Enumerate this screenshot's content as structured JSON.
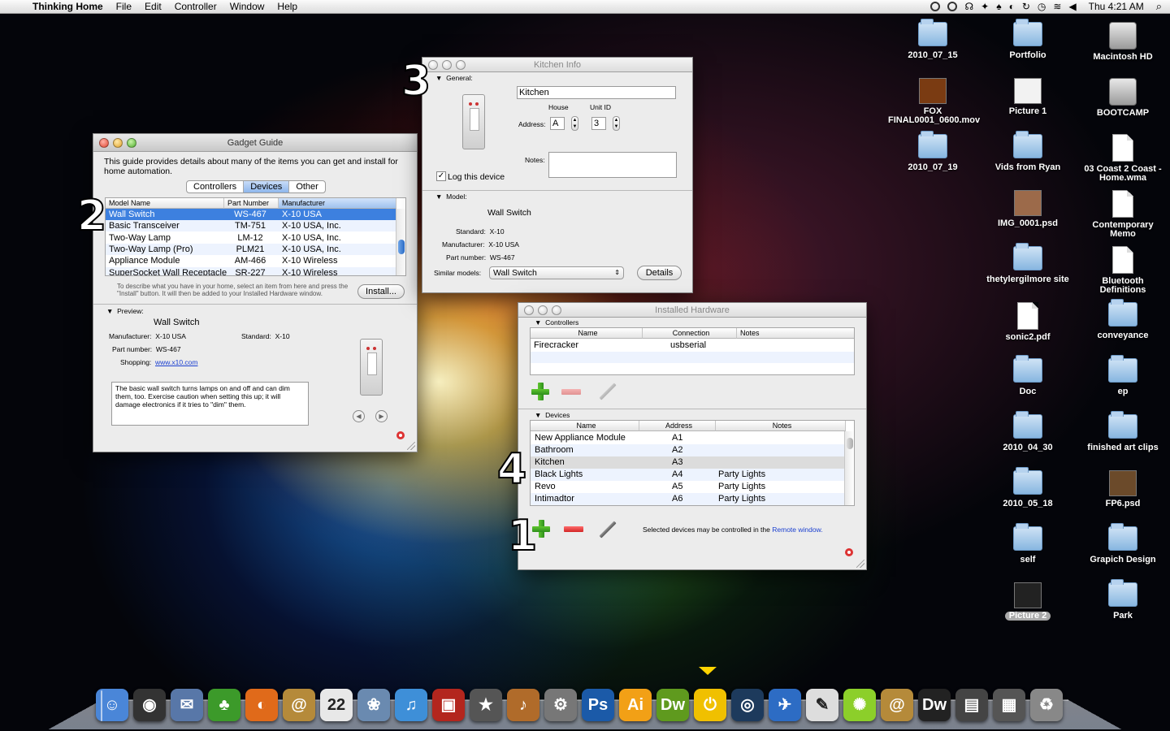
{
  "menubar": {
    "app": "Thinking Home",
    "items": [
      "File",
      "Edit",
      "Controller",
      "Window",
      "Help"
    ],
    "clock": "Thu 4:21 AM"
  },
  "gadget_guide": {
    "title": "Gadget Guide",
    "intro": "This guide provides details about many of the items you can get and install for home automation.",
    "tabs": [
      "Controllers",
      "Devices",
      "Other"
    ],
    "selected_tab": "Devices",
    "columns": [
      "Model Name",
      "Part Number",
      "Manufacturer"
    ],
    "rows": [
      {
        "name": "Wall Switch",
        "part": "WS-467",
        "mfr": "X-10 USA"
      },
      {
        "name": "Basic Transceiver",
        "part": "TM-751",
        "mfr": "X-10 USA, Inc."
      },
      {
        "name": "Two-Way Lamp",
        "part": "LM-12",
        "mfr": "X-10 USA, Inc."
      },
      {
        "name": "Two-Way Lamp (Pro)",
        "part": "PLM21",
        "mfr": "X-10 USA, Inc."
      },
      {
        "name": "Appliance Module",
        "part": "AM-466",
        "mfr": "X-10 Wireless"
      },
      {
        "name": "SuperSocket Wall Receptacle",
        "part": "SR-227",
        "mfr": "X-10 Wireless"
      }
    ],
    "hint": "To describe what you have in your home, select an item from here and press the \"Install\" button. It will then be added to your Installed Hardware window.",
    "install_label": "Install...",
    "preview_label": "Preview:",
    "preview_title": "Wall Switch",
    "manufacturer_label": "Manufacturer:",
    "manufacturer": "X-10 USA",
    "standard_label": "Standard:",
    "standard": "X-10",
    "part_label": "Part number:",
    "part": "WS-467",
    "shopping_label": "Shopping:",
    "shopping": "www.x10.com",
    "description": "The basic wall switch turns lamps on and off and can dim them, too. Exercise caution when setting this up; it will damage electronics if it tries to \"dim\" them."
  },
  "kitchen_info": {
    "title": "Kitchen Info",
    "general_label": "General:",
    "name_value": "Kitchen",
    "house_label": "House",
    "unit_label": "Unit ID",
    "address_label": "Address:",
    "house": "A",
    "unit": "3",
    "notes_label": "Notes:",
    "log_label": "Log this device",
    "log_checked": true,
    "model_label": "Model:",
    "model_title": "Wall Switch",
    "standard_label": "Standard:",
    "standard": "X-10",
    "manufacturer_label": "Manufacturer:",
    "manufacturer": "X-10 USA",
    "part_label": "Part number:",
    "part": "WS-467",
    "similar_label": "Similar models:",
    "similar_value": "Wall Switch",
    "details_label": "Details"
  },
  "installed_hardware": {
    "title": "Installed Hardware",
    "controllers_label": "Controllers",
    "controller_columns": [
      "Name",
      "Connection",
      "Notes"
    ],
    "controllers": [
      {
        "name": "Firecracker",
        "connection": "usbserial",
        "notes": ""
      }
    ],
    "devices_label": "Devices",
    "device_columns": [
      "Name",
      "Address",
      "Notes"
    ],
    "devices": [
      {
        "name": "New Appliance Module",
        "address": "A1",
        "notes": ""
      },
      {
        "name": "Bathroom",
        "address": "A2",
        "notes": ""
      },
      {
        "name": "Kitchen",
        "address": "A3",
        "notes": ""
      },
      {
        "name": "Black Lights",
        "address": "A4",
        "notes": "Party Lights"
      },
      {
        "name": "Revo",
        "address": "A5",
        "notes": "Party Lights"
      },
      {
        "name": "Intimadtor",
        "address": "A6",
        "notes": "Party Lights"
      }
    ],
    "footer_text": "Selected devices may be controlled in the",
    "footer_link": "Remote window."
  },
  "callouts": [
    "1",
    "2",
    "3",
    "4"
  ],
  "desktop_icons": [
    {
      "label": "2010_07_15",
      "kind": "folder"
    },
    {
      "label": "Portfolio",
      "kind": "folder"
    },
    {
      "label": "Macintosh HD",
      "kind": "drive"
    },
    {
      "label": "FOX FINAL0001_0600.mov",
      "kind": "image"
    },
    {
      "label": "Picture 1",
      "kind": "image"
    },
    {
      "label": "BOOTCAMP",
      "kind": "drive"
    },
    {
      "label": "2010_07_19",
      "kind": "folder"
    },
    {
      "label": "Vids from Ryan",
      "kind": "folder"
    },
    {
      "label": "03 Coast 2 Coast - Home.wma",
      "kind": "doc"
    },
    {
      "label": "IMG_0001.psd",
      "kind": "image"
    },
    {
      "label": "Contemporary Memo",
      "kind": "doc"
    },
    {
      "label": "thetylergilmore site",
      "kind": "folder"
    },
    {
      "label": "Bluetooth Definitions",
      "kind": "doc"
    },
    {
      "label": "sonic2.pdf",
      "kind": "doc"
    },
    {
      "label": "conveyance",
      "kind": "folder"
    },
    {
      "label": "Doc",
      "kind": "folder"
    },
    {
      "label": "ep",
      "kind": "folder"
    },
    {
      "label": "2010_04_30",
      "kind": "folder"
    },
    {
      "label": "finished art clips",
      "kind": "folder"
    },
    {
      "label": "2010_05_18",
      "kind": "folder"
    },
    {
      "label": "FP6.psd",
      "kind": "image"
    },
    {
      "label": "self",
      "kind": "folder"
    },
    {
      "label": "Grapich Design",
      "kind": "folder"
    },
    {
      "label": "Picture 2",
      "kind": "image"
    },
    {
      "label": "Park",
      "kind": "folder"
    }
  ],
  "dock": [
    {
      "name": "finder-icon",
      "glyph": "☺",
      "color": "#4a86d8"
    },
    {
      "name": "dashboard-icon",
      "glyph": "◉",
      "color": "#333"
    },
    {
      "name": "mail-stamp-icon",
      "glyph": "✉",
      "color": "#5877a8"
    },
    {
      "name": "adium-icon",
      "glyph": "♣",
      "color": "#3c9a2a"
    },
    {
      "name": "firefox-icon",
      "glyph": "◐",
      "color": "#e06a1a"
    },
    {
      "name": "address-book-icon",
      "glyph": "@",
      "color": "#b58a3a"
    },
    {
      "name": "ical-icon",
      "glyph": "22",
      "color": "#e8e8e8"
    },
    {
      "name": "iphoto-icon",
      "glyph": "❀",
      "color": "#6a8ab0"
    },
    {
      "name": "itunes-icon",
      "glyph": "♫",
      "color": "#3e8fd8"
    },
    {
      "name": "photo-booth-icon",
      "glyph": "▣",
      "color": "#b3261e"
    },
    {
      "name": "imovie-icon",
      "glyph": "★",
      "color": "#555"
    },
    {
      "name": "garageband-icon",
      "glyph": "♪",
      "color": "#b06b2a"
    },
    {
      "name": "system-preferences-icon",
      "glyph": "⚙",
      "color": "#777"
    },
    {
      "name": "photoshop-icon",
      "glyph": "Ps",
      "color": "#1b5aa8"
    },
    {
      "name": "illustrator-icon",
      "glyph": "Ai",
      "color": "#f2a016"
    },
    {
      "name": "dreamweaver-icon",
      "glyph": "Dw",
      "color": "#5f9a1e"
    },
    {
      "name": "thinking-home-icon",
      "glyph": "⏻",
      "color": "#f0c000"
    },
    {
      "name": "gamepad-icon",
      "glyph": "◎",
      "color": "#1d3a5c"
    },
    {
      "name": "xlr8-icon",
      "glyph": "✈",
      "color": "#2d6cc4"
    },
    {
      "name": "textedit-icon",
      "glyph": "✎",
      "color": "#ddd"
    },
    {
      "name": "lime-icon",
      "glyph": "✺",
      "color": "#8ccf2a"
    },
    {
      "name": "documents-stack-icon",
      "glyph": "@",
      "color": "#b58a3a"
    },
    {
      "name": "dreamweaver-stack-icon",
      "glyph": "Dw",
      "color": "#222"
    },
    {
      "name": "screenshots-stack-icon",
      "glyph": "▤",
      "color": "#444"
    },
    {
      "name": "downloads-stack-icon",
      "glyph": "▦",
      "color": "#555"
    },
    {
      "name": "trash-icon",
      "glyph": "♻",
      "color": "#888"
    }
  ]
}
